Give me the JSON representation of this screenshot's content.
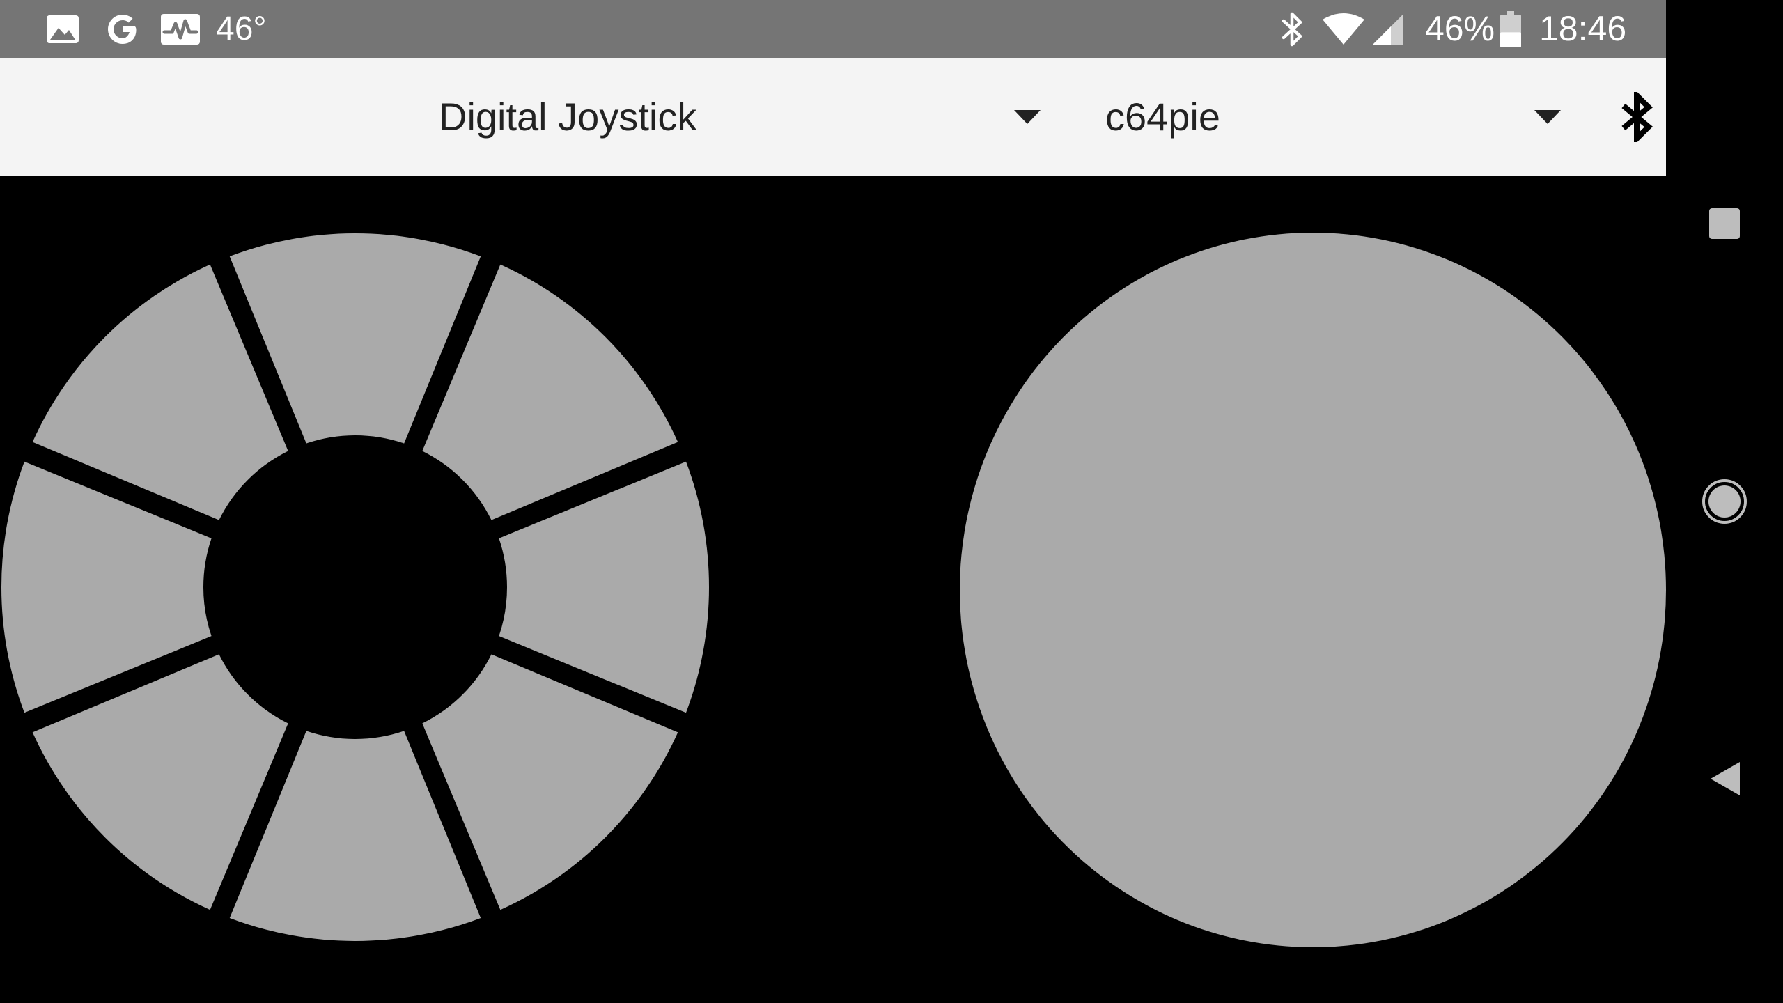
{
  "status_bar": {
    "temperature": "46°",
    "battery_percent": "46%",
    "time": "18:46",
    "battery_level": 0.46,
    "left_icons": [
      "image-icon",
      "google-icon",
      "activity-icon"
    ],
    "right_icons": [
      "bluetooth-icon",
      "wifi-icon",
      "cell-signal-icon",
      "battery-icon"
    ]
  },
  "toolbar": {
    "mode_spinner": {
      "selected": "Digital Joystick"
    },
    "device_spinner": {
      "selected": "c64pie"
    },
    "bluetooth_button_icon": "bluetooth-icon"
  },
  "controls": {
    "dpad_segments": [
      "up",
      "up-right",
      "right",
      "down-right",
      "down",
      "down-left",
      "left",
      "up-left"
    ],
    "segment_color": "#aaaaaa",
    "background_color": "#000000"
  },
  "nav_bar": {
    "buttons": [
      "recents-icon",
      "home-icon",
      "back-icon"
    ]
  },
  "colors": {
    "status_bar": "#757575",
    "toolbar": "#f4f4f4",
    "text": "#222222"
  }
}
